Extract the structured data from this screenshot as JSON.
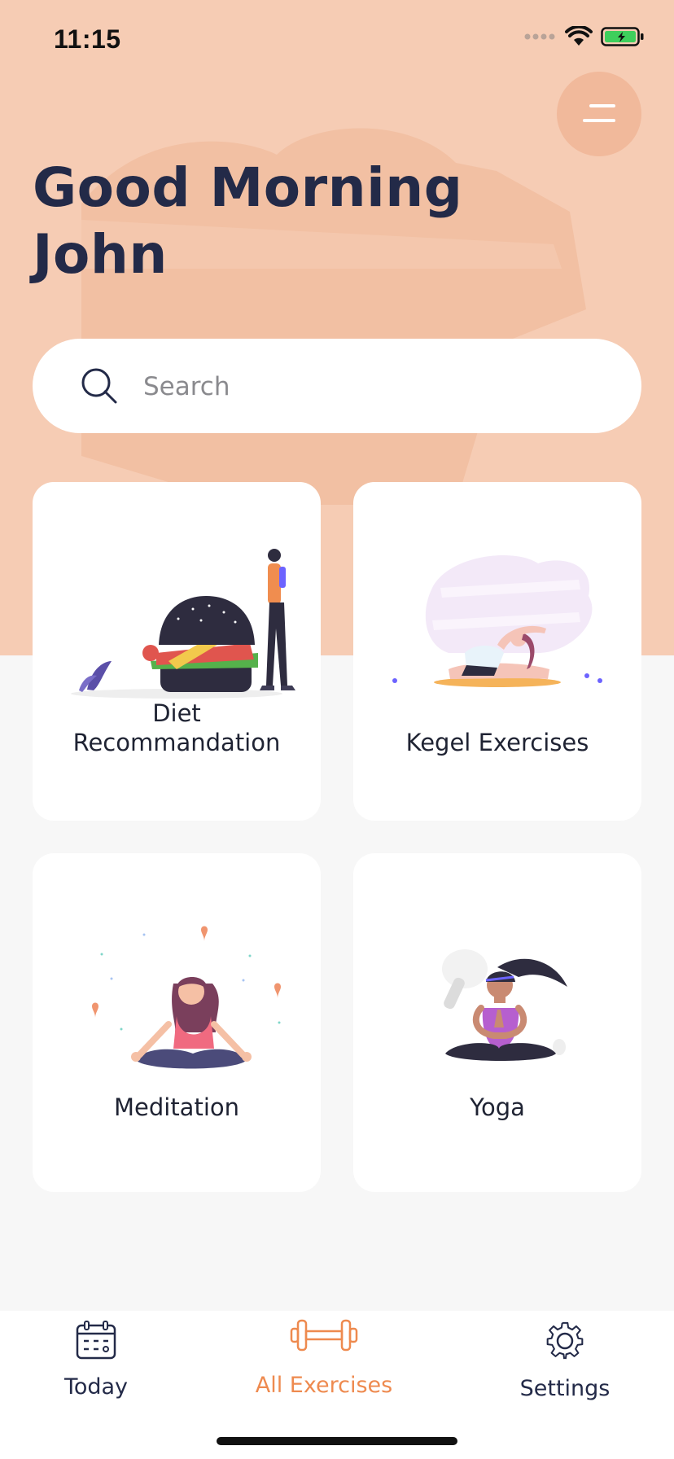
{
  "status": {
    "time": "11:15"
  },
  "header": {
    "greeting_line1": "Good Morning",
    "greeting_line2": "John"
  },
  "search": {
    "placeholder": "Search"
  },
  "cards": [
    {
      "label": "Diet\nRecommandation",
      "illustration": "burger-and-person-illustration"
    },
    {
      "label": "Kegel Exercises",
      "illustration": "stretching-woman-illustration"
    },
    {
      "label": "Meditation",
      "illustration": "meditating-woman-illustration"
    },
    {
      "label": "Yoga",
      "illustration": "yoga-woman-illustration"
    }
  ],
  "tabs": [
    {
      "label": "Today",
      "icon": "calendar-icon",
      "active": false
    },
    {
      "label": "All Exercises",
      "icon": "dumbbell-icon",
      "active": true
    },
    {
      "label": "Settings",
      "icon": "gear-icon",
      "active": false
    }
  ],
  "colors": {
    "hero_background": "#f6ccb4",
    "menu_button": "#f1b99b",
    "accent": "#ee8a4f",
    "heading_text": "#232a48",
    "page_background": "#f7f7f7"
  }
}
